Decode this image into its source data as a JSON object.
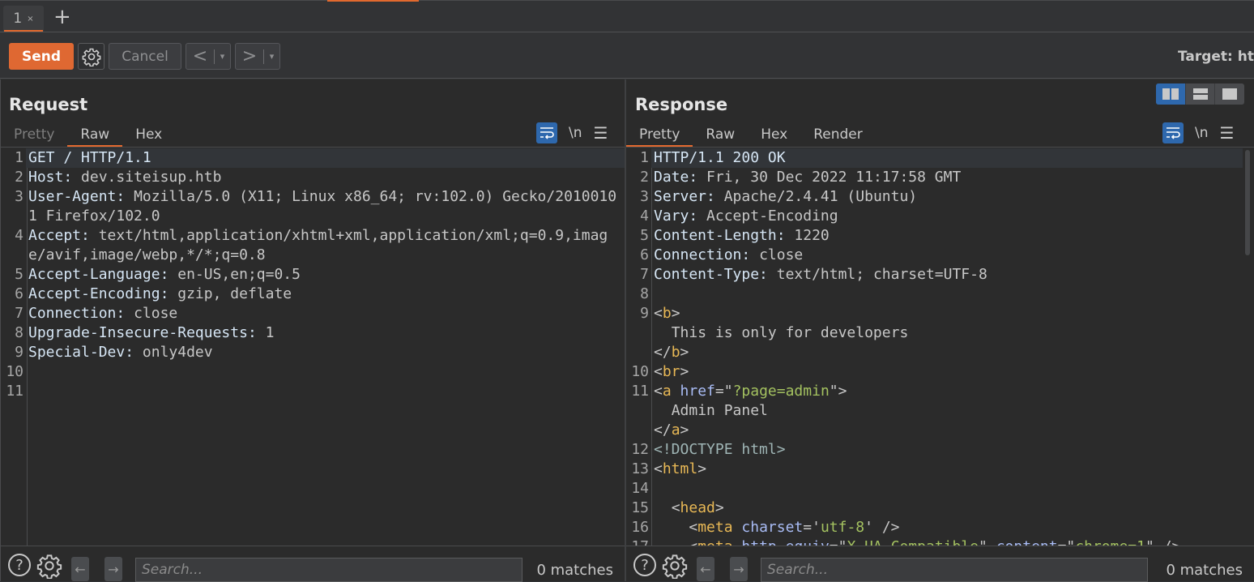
{
  "tabs": [
    {
      "label": "1",
      "close": "×"
    }
  ],
  "add_tab": "+",
  "toolbar": {
    "send_label": "Send",
    "cancel_label": "Cancel",
    "back_label": "<",
    "forward_label": ">",
    "dropdown_glyph": "▾",
    "target_label": "Target: ht"
  },
  "colors": {
    "accent": "#e2692e",
    "send": "#df6832",
    "toggle_active": "#2e68ad"
  },
  "request": {
    "title": "Request",
    "tabs": [
      "Pretty",
      "Raw",
      "Hex"
    ],
    "active_tab": "Raw",
    "newline_label": "\\n",
    "lines": [
      {
        "n": "1",
        "key": "GET / HTTP/1.1",
        "val": ""
      },
      {
        "n": "2",
        "key": "Host",
        "val": "dev.siteisup.htb"
      },
      {
        "n": "3",
        "key": "User-Agent",
        "val": "Mozilla/5.0 (X11; Linux x86_64; rv:102.0) Gecko/20100101 Firefox/102.0"
      },
      {
        "n": "4",
        "key": "Accept",
        "val": "text/html,application/xhtml+xml,application/xml;q=0.9,image/avif,image/webp,*/*;q=0.8"
      },
      {
        "n": "5",
        "key": "Accept-Language",
        "val": "en-US,en;q=0.5"
      },
      {
        "n": "6",
        "key": "Accept-Encoding",
        "val": "gzip, deflate"
      },
      {
        "n": "7",
        "key": "Connection",
        "val": "close"
      },
      {
        "n": "8",
        "key": "Upgrade-Insecure-Requests",
        "val": "1"
      },
      {
        "n": "9",
        "key": "Special-Dev",
        "val": "only4dev"
      },
      {
        "n": "10",
        "key": "",
        "val": ""
      },
      {
        "n": "11",
        "key": "",
        "val": ""
      }
    ],
    "search_placeholder": "Search...",
    "matches": "0 matches"
  },
  "response": {
    "title": "Response",
    "tabs": [
      "Pretty",
      "Raw",
      "Hex",
      "Render"
    ],
    "active_tab": "Pretty",
    "newline_label": "\\n",
    "status_line": "HTTP/1.1 200 OK",
    "headers": [
      {
        "n": "2",
        "key": "Date",
        "val": "Fri, 30 Dec 2022 11:17:58 GMT"
      },
      {
        "n": "3",
        "key": "Server",
        "val": "Apache/2.4.41 (Ubuntu)"
      },
      {
        "n": "4",
        "key": "Vary",
        "val": "Accept-Encoding"
      },
      {
        "n": "5",
        "key": "Content-Length",
        "val": "1220"
      },
      {
        "n": "6",
        "key": "Connection",
        "val": "close"
      },
      {
        "n": "7",
        "key": "Content-Type",
        "val": "text/html; charset=UTF-8"
      }
    ],
    "body": {
      "b_text": "This is only for developers",
      "a_href": "?page=admin",
      "a_text": "Admin Panel",
      "doctype": "<!DOCTYPE html>",
      "meta_charset": "utf-8",
      "meta_equiv": "X-UA-Compatible",
      "meta_content": "chrome=1"
    },
    "search_placeholder": "Search...",
    "matches": "0 matches"
  }
}
